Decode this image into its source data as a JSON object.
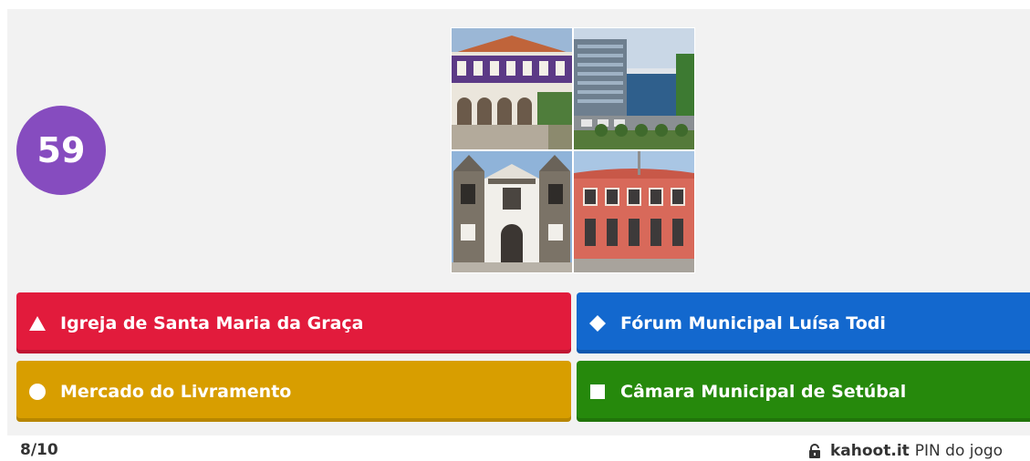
{
  "timer": {
    "value": "59"
  },
  "question_image": {
    "tiles": [
      "purple-building-photo",
      "modern-forum-building-photo",
      "church-facade-photo",
      "red-market-building-photo"
    ]
  },
  "answers": [
    {
      "shape": "triangle-icon",
      "label": "Igreja de Santa Maria da Graça",
      "color": "#e21b3c"
    },
    {
      "shape": "diamond-icon",
      "label": "Fórum Municipal Luísa Todi",
      "color": "#1368ce"
    },
    {
      "shape": "circle-icon",
      "label": "Mercado do Livramento",
      "color": "#d89e00"
    },
    {
      "shape": "square-icon",
      "label": "Câmara Municipal de Setúbal",
      "color": "#26890c"
    }
  ],
  "footer": {
    "progress": "8/10",
    "host": "kahoot.it",
    "pin_label": "PIN do jogo"
  }
}
